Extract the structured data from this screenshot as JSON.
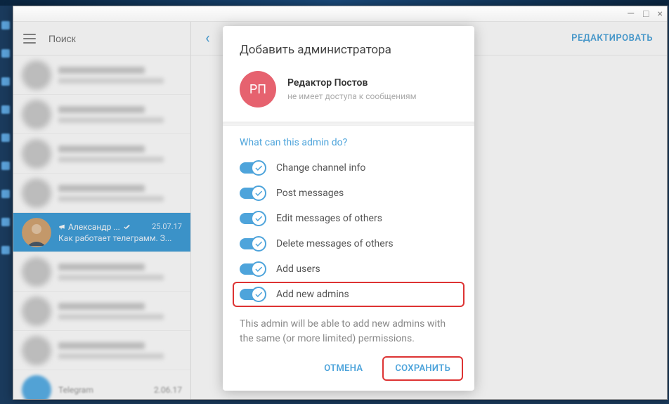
{
  "window_controls": {
    "min": "—",
    "max": "□",
    "close": "×"
  },
  "sidebar": {
    "search_placeholder": "Поиск",
    "selected": {
      "name": "Александр ...",
      "date": "25.07.17",
      "preview": "Как работает телеграмм. З..."
    },
    "bottom": {
      "name": "Telegram",
      "date": "2.06.17"
    }
  },
  "header": {
    "edit": "РЕДАКТИРОВАТЬ"
  },
  "modal": {
    "title": "Добавить администратора",
    "admin": {
      "initials": "РП",
      "name": "Редактор Постов",
      "sub": "не имеет доступа к сообщениям"
    },
    "section": "What can this admin do?",
    "perms": [
      {
        "label": "Change channel info",
        "on": true,
        "hl": false
      },
      {
        "label": "Post messages",
        "on": true,
        "hl": false
      },
      {
        "label": "Edit messages of others",
        "on": true,
        "hl": false
      },
      {
        "label": "Delete messages of others",
        "on": true,
        "hl": false
      },
      {
        "label": "Add users",
        "on": true,
        "hl": false
      },
      {
        "label": "Add new admins",
        "on": true,
        "hl": true
      }
    ],
    "note": "This admin will be able to add new admins with the same (or more limited) permissions.",
    "cancel": "ОТМЕНА",
    "save": "СОХРАНИТЬ"
  }
}
